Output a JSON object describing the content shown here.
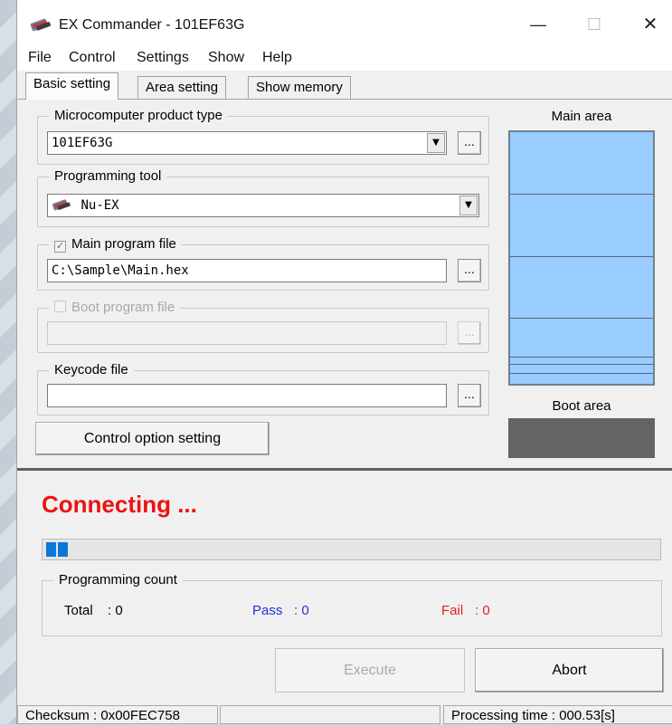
{
  "window": {
    "title": "EX Commander - 101EF63G",
    "min_glyph": "—",
    "max_glyph": "☐",
    "close_glyph": "✕",
    "icon": "ex-commander-icon"
  },
  "menu": [
    "File",
    "Control",
    "Settings",
    "Show",
    "Help"
  ],
  "tabs": [
    "Basic setting",
    "Area setting",
    "Show memory"
  ],
  "product": {
    "label": "Microcomputer product type",
    "value": "101EF63G"
  },
  "tool": {
    "label": "Programming tool",
    "value": "Nu-EX"
  },
  "main_program": {
    "label": "Main program file",
    "checked": true,
    "value": "C:\\Sample\\Main.hex"
  },
  "boot_program": {
    "label": "Boot program file",
    "checked": false,
    "enabled": false,
    "value": ""
  },
  "keycode": {
    "label": "Keycode file",
    "value": ""
  },
  "control_option_button": "Control option setting",
  "browse_glyph": "...",
  "dropdown_glyph": "▼",
  "memory": {
    "main_label": "Main area",
    "boot_label": "Boot area",
    "colors": {
      "main": "#99ccff",
      "boot": "#646464"
    }
  },
  "status": {
    "text": "Connecting ...",
    "color": "#ee1111"
  },
  "progress": {
    "blocks": 2
  },
  "counts": {
    "label": "Programming count",
    "total_label": "Total",
    "total_value": ": 0",
    "pass_label": "Pass",
    "pass_value": ": 0",
    "fail_label": "Fail",
    "fail_value": ": 0",
    "colors": {
      "pass": "#1a34d6",
      "fail": "#e02020"
    }
  },
  "buttons": {
    "execute": "Execute",
    "abort": "Abort"
  },
  "statusbar": {
    "checksum": "Checksum : 0x00FEC758",
    "middle": "",
    "processing_time": "Processing time :  000.53[s]"
  }
}
